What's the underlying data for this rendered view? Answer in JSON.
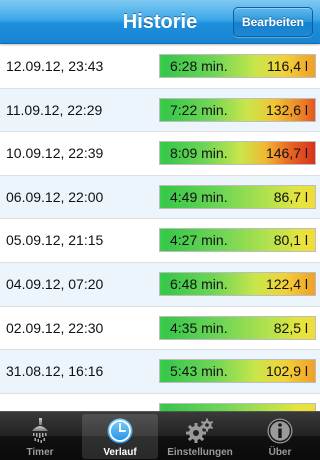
{
  "navbar": {
    "title": "Historie",
    "edit_label": "Bearbeiten"
  },
  "rows": [
    {
      "date": "12.09.12, 23:43",
      "duration": "6:28 min.",
      "volume": "116,4 l"
    },
    {
      "date": "11.09.12, 22:29",
      "duration": "7:22 min.",
      "volume": "132,6 l"
    },
    {
      "date": "10.09.12, 22:39",
      "duration": "8:09 min.",
      "volume": "146,7 l"
    },
    {
      "date": "06.09.12, 22:00",
      "duration": "4:49 min.",
      "volume": "86,7 l"
    },
    {
      "date": "05.09.12, 21:15",
      "duration": "4:27 min.",
      "volume": "80,1 l"
    },
    {
      "date": "04.09.12, 07:20",
      "duration": "6:48 min.",
      "volume": "122,4 l"
    },
    {
      "date": "02.09.12, 22:30",
      "duration": "4:35 min.",
      "volume": "82,5 l"
    },
    {
      "date": "31.08.12, 16:16",
      "duration": "5:43 min.",
      "volume": "102,9 l"
    }
  ],
  "tabs": [
    {
      "label": "Timer",
      "icon": "shower-icon"
    },
    {
      "label": "Verlauf",
      "icon": "clock-icon"
    },
    {
      "label": "Einstellungen",
      "icon": "gears-icon"
    },
    {
      "label": "Über",
      "icon": "info-icon"
    }
  ],
  "active_tab": "Verlauf"
}
